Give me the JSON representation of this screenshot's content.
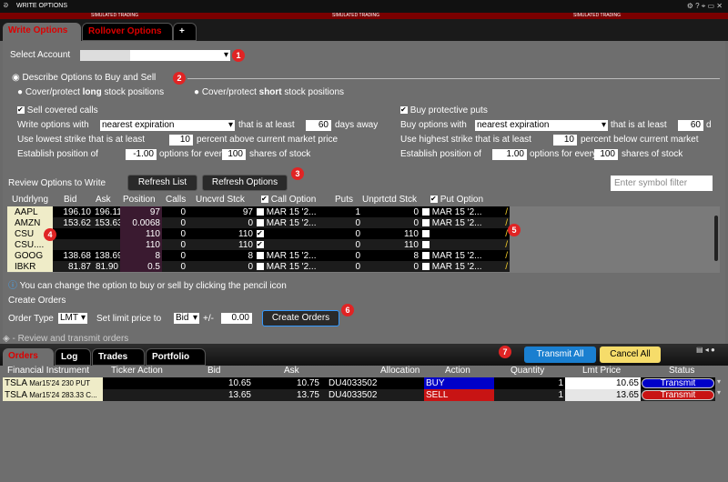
{
  "window": {
    "title": "WRITE OPTIONS",
    "sim_banner": "SIMULATED TRADING"
  },
  "tabs": [
    {
      "label": "Write Options",
      "active": true
    },
    {
      "label": "Rollover Options"
    },
    {
      "label": "+"
    }
  ],
  "account": {
    "label": "Select Account",
    "value": ""
  },
  "describe": {
    "title": "Describe Options to Buy and Sell",
    "radio_long": "Cover/protect ",
    "radio_long_bold": "long",
    "radio_long_tail": " stock positions",
    "radio_short": "Cover/protect ",
    "radio_short_bold": "short",
    "radio_short_tail": " stock positions"
  },
  "calls": {
    "title": "Sell covered calls",
    "write_with": "Write options with",
    "expiration": "nearest expiration",
    "at_least": "that is at least",
    "days": "60",
    "days_away": "days away",
    "lowest_strike": "Use lowest strike that is at least",
    "pct": "10",
    "pct_tail": "percent above current market price",
    "establish": "Establish position of",
    "pos": "-1.00",
    "options_for": "options for every",
    "shares": "100",
    "shares_tail": "shares of stock"
  },
  "puts": {
    "title": "Buy protective puts",
    "buy_with": "Buy options with",
    "expiration": "nearest expiration",
    "at_least": "that is at least",
    "days": "60",
    "days_away": "d",
    "highest_strike": "Use highest strike that is at least",
    "pct": "10",
    "pct_tail": "percent below current market",
    "establish": "Establish position of",
    "pos": "1.00",
    "options_for": "options for every",
    "shares": "100",
    "shares_tail": "shares of stock"
  },
  "review": {
    "title": "Review Options to Write",
    "refresh_list": "Refresh List",
    "refresh_options": "Refresh Options",
    "filter_placeholder": "Enter symbol filter"
  },
  "columns": [
    "Undrlyng",
    "Bid",
    "Ask",
    "Position",
    "Calls",
    "Uncvrd Stck",
    "Call Option",
    "Puts",
    "Unprtctd Stck",
    "Put Option"
  ],
  "rows": [
    {
      "sym": "AAPL",
      "bid": "196.10",
      "ask": "196.11",
      "pos": "97",
      "calls": "0",
      "uncv": "97",
      "call_chk": false,
      "call_opt": "MAR 15 '2...",
      "puts": "1",
      "unpr": "0",
      "put_chk": false,
      "put_opt": "MAR 15 '2..."
    },
    {
      "sym": "AMZN",
      "bid": "153.62",
      "ask": "153.63",
      "pos": "0.0068",
      "calls": "0",
      "uncv": "0",
      "call_chk": false,
      "call_opt": "MAR 15 '2...",
      "puts": "0",
      "unpr": "0",
      "put_chk": false,
      "put_opt": "MAR 15 '2..."
    },
    {
      "sym": "CSU",
      "bid": "",
      "ask": "",
      "pos": "110",
      "calls": "0",
      "uncv": "110",
      "call_chk": true,
      "call_opt": "",
      "puts": "0",
      "unpr": "110",
      "put_chk": false,
      "put_opt": ""
    },
    {
      "sym": "CSU....",
      "bid": "",
      "ask": "",
      "pos": "110",
      "calls": "0",
      "uncv": "110",
      "call_chk": true,
      "call_opt": "",
      "puts": "0",
      "unpr": "110",
      "put_chk": false,
      "put_opt": ""
    },
    {
      "sym": "GOOG",
      "bid": "138.68",
      "ask": "138.69",
      "pos": "8",
      "calls": "0",
      "uncv": "8",
      "call_chk": false,
      "call_opt": "MAR 15 '2...",
      "puts": "0",
      "unpr": "8",
      "put_chk": false,
      "put_opt": "MAR 15 '2..."
    },
    {
      "sym": "IBKR",
      "bid": "81.87",
      "ask": "81.90",
      "pos": "0.5",
      "calls": "0",
      "uncv": "0",
      "call_chk": false,
      "call_opt": "MAR 15 '2...",
      "puts": "0",
      "unpr": "0",
      "put_chk": false,
      "put_opt": "MAR 15 '2..."
    }
  ],
  "info": "You can change the option to buy or sell by clicking the pencil icon",
  "create": {
    "title": "Create Orders",
    "order_type_label": "Order Type",
    "order_type": "LMT",
    "limit_label": "Set limit price to",
    "limit_ref": "Bid",
    "offset_label": "+/-",
    "offset": "0.00",
    "button": "Create Orders"
  },
  "transmit_section": "Review and transmit orders",
  "order_tabs": [
    "Orders",
    "Log",
    "Trades",
    "Portfolio"
  ],
  "transmit_all": "Transmit All",
  "cancel_all": "Cancel All",
  "order_columns": [
    "Financial Instrument",
    "Ticker Action",
    "Bid",
    "Ask",
    "Allocation",
    "Action",
    "Quantity",
    "Lmt Price",
    "Status"
  ],
  "orders": [
    {
      "sym": "TSLA",
      "desc": "Mar15'24 230 PUT",
      "bid": "10.65",
      "ask": "10.75",
      "alloc": "DU4033502",
      "action": "BUY",
      "qty": "1",
      "lmt": "10.65",
      "status": "Transmit",
      "color": "#0000c8"
    },
    {
      "sym": "TSLA",
      "desc": "Mar15'24 283.33 C...",
      "bid": "13.65",
      "ask": "13.75",
      "alloc": "DU4033502",
      "action": "SELL",
      "qty": "1",
      "lmt": "13.65",
      "status": "Transmit",
      "color": "#c81414"
    }
  ],
  "badges": [
    "1",
    "2",
    "3",
    "4",
    "5",
    "6",
    "7"
  ]
}
